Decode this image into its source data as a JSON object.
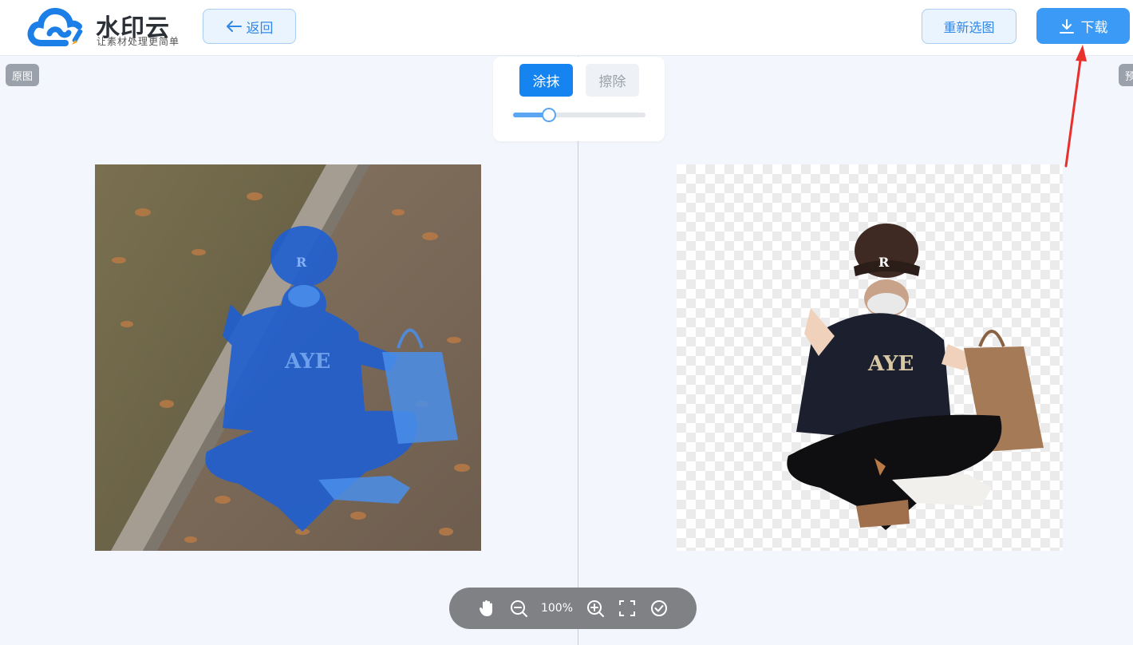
{
  "app": {
    "brand_name": "水印云",
    "brand_slogan": "让素材处理更简单",
    "accent_color": "#1584f0"
  },
  "header": {
    "back_label": "返回",
    "reselect_label": "重新选图",
    "download_label": "下载"
  },
  "panels": {
    "original_tag": "原图",
    "preview_tag": "预"
  },
  "tools": {
    "paint_label": "涂抹",
    "erase_label": "擦除",
    "brush_size_fraction": 0.27
  },
  "zoom": {
    "level": "100%"
  },
  "icons": {
    "back": "arrow-left-icon",
    "download": "download-icon",
    "hand": "hand-icon",
    "zoom_out": "zoom-out-icon",
    "zoom_in": "zoom-in-icon",
    "fit": "fullscreen-icon",
    "confirm": "check-circle-icon"
  }
}
